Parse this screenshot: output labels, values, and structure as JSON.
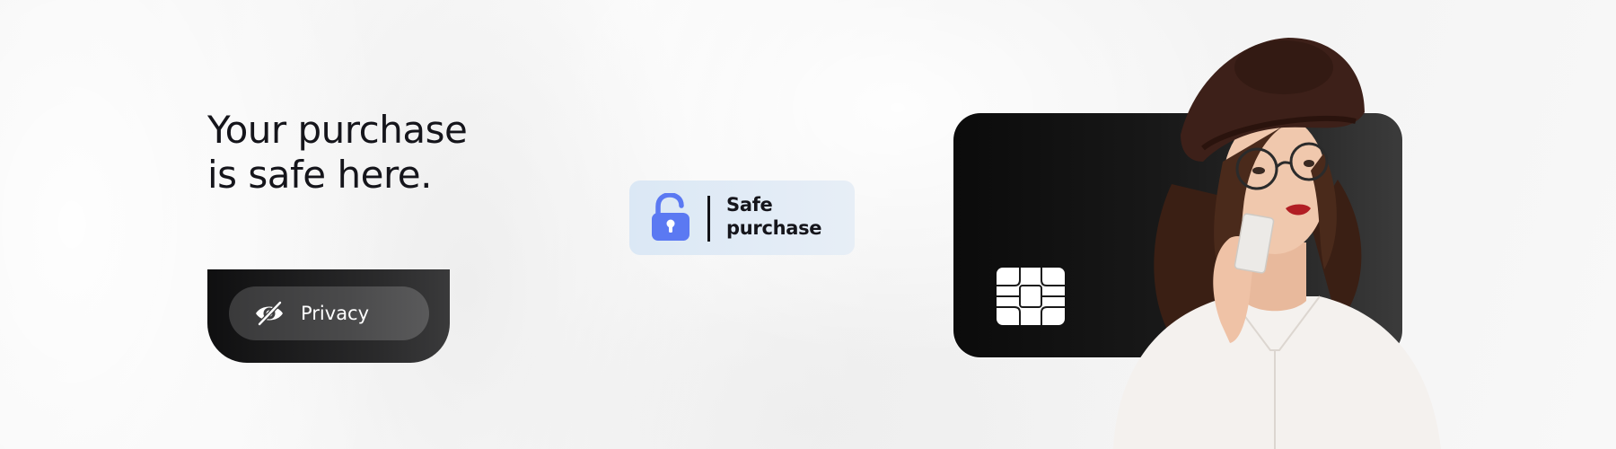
{
  "headline": "Your purchase is safe here.",
  "privacy": {
    "label": "Privacy",
    "icon": "eye-slash-icon"
  },
  "badge": {
    "line1": "Safe",
    "line2": "purchase",
    "icon": "unlocked-padlock-icon",
    "icon_color": "#5b79f2",
    "background_color": "#e0ebf6"
  },
  "card": {
    "chip_icon": "card-chip-icon",
    "background_color": "#111111"
  },
  "person": {
    "description_icon": "woman-holding-card-photo"
  }
}
